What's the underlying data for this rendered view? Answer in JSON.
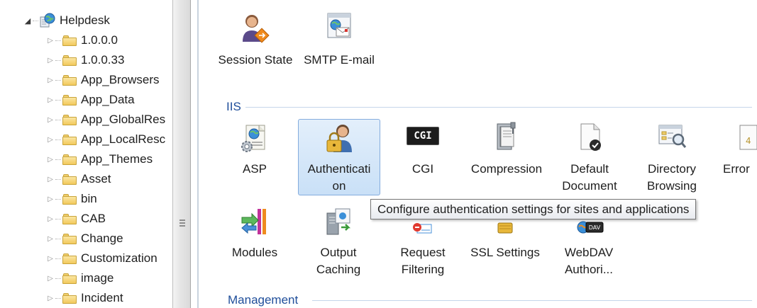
{
  "tree": {
    "site_label": "Helpdesk",
    "items": [
      {
        "label": "1.0.0.0"
      },
      {
        "label": "1.0.0.33"
      },
      {
        "label": "App_Browsers"
      },
      {
        "label": "App_Data"
      },
      {
        "label": "App_GlobalRes"
      },
      {
        "label": "App_LocalResc"
      },
      {
        "label": "App_Themes"
      },
      {
        "label": "Asset"
      },
      {
        "label": "bin"
      },
      {
        "label": "CAB"
      },
      {
        "label": "Change"
      },
      {
        "label": "Customization"
      },
      {
        "label": "image"
      },
      {
        "label": "Incident"
      }
    ]
  },
  "features": {
    "top_row": [
      {
        "label": "Session State",
        "icon": "session-state-icon"
      },
      {
        "label": "SMTP E-mail",
        "icon": "smtp-email-icon"
      }
    ],
    "iis_group_title": "IIS",
    "iis_row1": [
      {
        "label": "ASP",
        "icon": "asp-icon"
      },
      {
        "label_line1": "Authenticati",
        "label_line2": "on",
        "icon": "authentication-icon"
      },
      {
        "label": "CGI",
        "icon": "cgi-icon",
        "badge": "CGI"
      },
      {
        "label": "Compression",
        "icon": "compression-icon"
      },
      {
        "label_line1": "Default",
        "label_line2": "Document",
        "icon": "default-document-icon"
      },
      {
        "label_line1": "Directory",
        "label_line2": "Browsing",
        "icon": "directory-browsing-icon"
      },
      {
        "label": "Error",
        "icon": "error-pages-icon"
      }
    ],
    "iis_row2": [
      {
        "label": "Modules",
        "icon": "modules-icon"
      },
      {
        "label_line1": "Output",
        "label_line2": "Caching",
        "icon": "output-caching-icon"
      },
      {
        "label_line1": "Request",
        "label_line2": "Filtering",
        "icon": "request-filtering-icon"
      },
      {
        "label": "SSL Settings",
        "icon": "ssl-settings-icon"
      },
      {
        "label_line1": "WebDAV",
        "label_line2": "Authori...",
        "icon": "webdav-icon",
        "badge": "DAV"
      }
    ],
    "management_group_title": "Management"
  },
  "tooltip": {
    "text": "Configure authentication settings for sites and applications"
  },
  "colors": {
    "group_title": "#1f4e9a",
    "selection_fill": "#c9e0f7",
    "selection_border": "#84acdd"
  }
}
